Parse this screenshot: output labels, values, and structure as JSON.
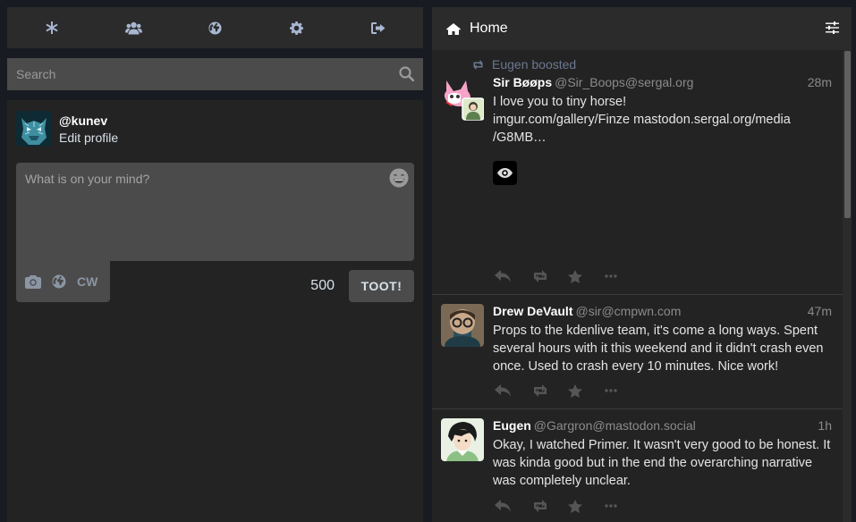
{
  "nav": {
    "items": [
      {
        "name": "getting-started",
        "icon": "asterisk-icon"
      },
      {
        "name": "local-timeline",
        "icon": "users-icon"
      },
      {
        "name": "federated-timeline",
        "icon": "globe-icon"
      },
      {
        "name": "preferences",
        "icon": "gear-icon"
      },
      {
        "name": "logout",
        "icon": "sign-out-icon"
      }
    ]
  },
  "search": {
    "placeholder": "Search",
    "icon": "search-icon"
  },
  "profile": {
    "handle": "@kunev",
    "edit_label": "Edit profile"
  },
  "compose": {
    "placeholder": "What is on your mind?",
    "cw_label": "CW",
    "char_count": "500",
    "submit_label": "TOOT!"
  },
  "column": {
    "title": "Home",
    "icon": "home-icon",
    "settings_icon": "sliders-icon"
  },
  "statuses": [
    {
      "boosted_by": "Eugen boosted",
      "display_name": "Sir Bøøps",
      "acct": "@Sir_Boops@sergal.org",
      "time": "28m",
      "content_line1": "I love you to tiny horse!",
      "content_line2": "imgur.com/gallery/Finze mastodon.sergal.org/media",
      "content_line3": "/G8MB…",
      "has_sensitive_media": true
    },
    {
      "display_name": "Drew DeVault",
      "acct": "@sir@cmpwn.com",
      "time": "47m",
      "content": "Props to the kdenlive team, it's come a long ways. Spent several hours with it this weekend and it didn't crash even once. Used to crash every 10 minutes. Nice work!"
    },
    {
      "display_name": "Eugen",
      "acct": "@Gargron@mastodon.social",
      "time": "1h",
      "content": "Okay, I watched Primer. It wasn't very good to be honest. It was kinda good but in the end the overarching narrative was completely unclear."
    }
  ],
  "colors": {
    "background": "#191b22",
    "panel": "#232323",
    "header": "#2b2b2b",
    "input": "#4b4b4b",
    "icon": "#a8b7d1",
    "muted": "#8b8b8b"
  }
}
